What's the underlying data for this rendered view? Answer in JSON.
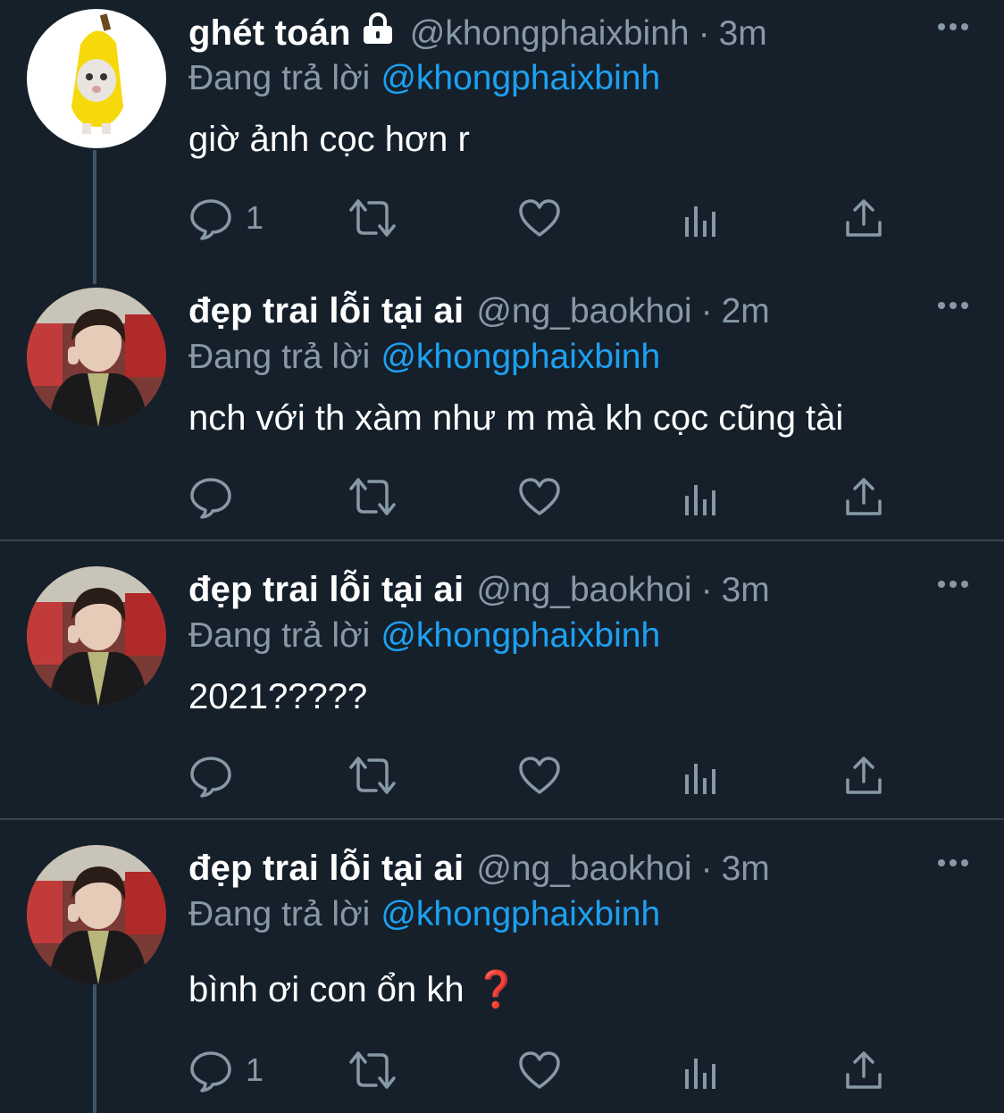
{
  "theme": {
    "background": "#15202b",
    "divider": "#38444d",
    "secondary_text": "#8899a6",
    "accent": "#1da1f2"
  },
  "tweets": [
    {
      "name": "ghét toán",
      "protected": true,
      "handle": "@khongphaixbinh",
      "time": "3m",
      "replying_prefix": "Đang trả lời",
      "replying_to": "@khongphaixbinh",
      "text": "giờ ảnh cọc hơn r",
      "reply_count": "1",
      "avatar": "banana-cat-avatar"
    },
    {
      "name": "đẹp trai lỗi tại ai",
      "protected": false,
      "handle": "@ng_baokhoi",
      "time": "2m",
      "replying_prefix": "Đang trả lời",
      "replying_to": "@khongphaixbinh",
      "text": "nch với th xàm như m mà kh cọc cũng tài",
      "reply_count": "",
      "avatar": "portrait-avatar"
    },
    {
      "name": "đẹp trai lỗi tại ai",
      "protected": false,
      "handle": "@ng_baokhoi",
      "time": "3m",
      "replying_prefix": "Đang trả lời",
      "replying_to": "@khongphaixbinh",
      "text": "2021?????",
      "reply_count": "",
      "avatar": "portrait-avatar"
    },
    {
      "name": "đẹp trai lỗi tại ai",
      "protected": false,
      "handle": "@ng_baokhoi",
      "time": "3m",
      "replying_prefix": "Đang trả lời",
      "replying_to": "@khongphaixbinh",
      "text": "bình ơi con ổn kh",
      "text_emoji": "❓",
      "reply_count": "1",
      "avatar": "portrait-avatar"
    }
  ],
  "dot": "·"
}
